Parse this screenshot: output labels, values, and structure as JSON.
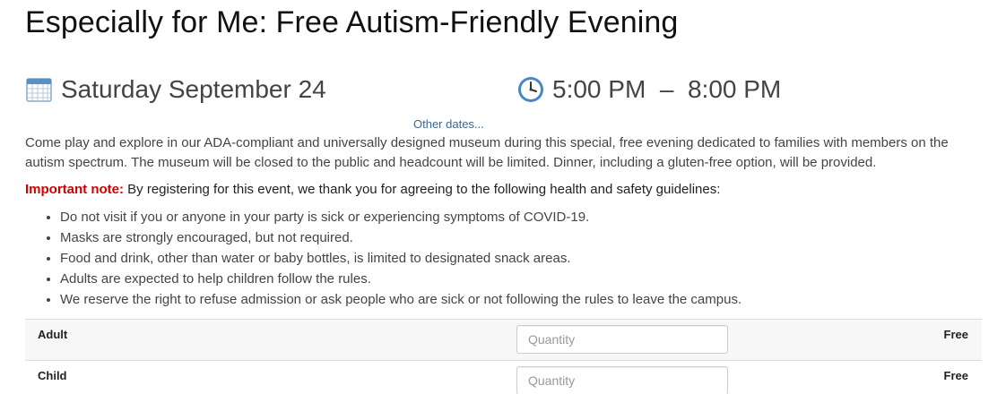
{
  "event": {
    "title": "Especially for Me: Free Autism-Friendly Evening",
    "date": "Saturday September 24",
    "time": "5:00 PM  –  8:00 PM",
    "other_dates_link": "Other dates...",
    "description": "Come play and explore in our ADA-compliant and universally designed museum during this special, free evening dedicated to families with members on the autism spectrum. The museum will be closed to the public and headcount will be limited. Dinner, including a gluten-free option, will be provided.",
    "note_label": "Important note:",
    "note_text": " By registering for this event, we thank you for agreeing to the following health and safety guidelines:",
    "rules": [
      "Do not visit if you or anyone in your party is sick or experiencing symptoms of COVID-19.",
      "Masks are strongly encouraged, but not required.",
      "Food and drink, other than water or baby bottles, is limited to designated snack areas.",
      "Adults are expected to help children follow the rules.",
      "We reserve the right to refuse admission or ask people who are sick or not following the rules to leave the campus."
    ]
  },
  "icons": {
    "date": "calendar-icon",
    "time": "clock-icon"
  },
  "tickets": [
    {
      "name": "Adult",
      "placeholder": "Quantity",
      "price": "Free"
    },
    {
      "name": "Child",
      "placeholder": "Quantity",
      "price": "Free"
    }
  ],
  "colors": {
    "important_label": "#d40000",
    "link": "#3a6a8a"
  }
}
